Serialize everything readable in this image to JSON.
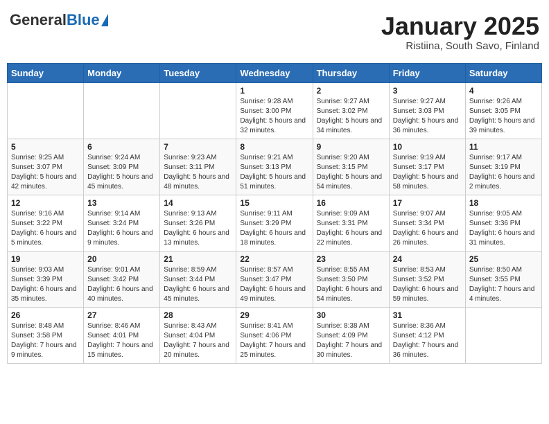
{
  "header": {
    "logo_general": "General",
    "logo_blue": "Blue",
    "month_title": "January 2025",
    "subtitle": "Ristiina, South Savo, Finland"
  },
  "weekdays": [
    "Sunday",
    "Monday",
    "Tuesday",
    "Wednesday",
    "Thursday",
    "Friday",
    "Saturday"
  ],
  "weeks": [
    [
      {
        "day": "",
        "text": ""
      },
      {
        "day": "",
        "text": ""
      },
      {
        "day": "",
        "text": ""
      },
      {
        "day": "1",
        "text": "Sunrise: 9:28 AM\nSunset: 3:00 PM\nDaylight: 5 hours and 32 minutes."
      },
      {
        "day": "2",
        "text": "Sunrise: 9:27 AM\nSunset: 3:02 PM\nDaylight: 5 hours and 34 minutes."
      },
      {
        "day": "3",
        "text": "Sunrise: 9:27 AM\nSunset: 3:03 PM\nDaylight: 5 hours and 36 minutes."
      },
      {
        "day": "4",
        "text": "Sunrise: 9:26 AM\nSunset: 3:05 PM\nDaylight: 5 hours and 39 minutes."
      }
    ],
    [
      {
        "day": "5",
        "text": "Sunrise: 9:25 AM\nSunset: 3:07 PM\nDaylight: 5 hours and 42 minutes."
      },
      {
        "day": "6",
        "text": "Sunrise: 9:24 AM\nSunset: 3:09 PM\nDaylight: 5 hours and 45 minutes."
      },
      {
        "day": "7",
        "text": "Sunrise: 9:23 AM\nSunset: 3:11 PM\nDaylight: 5 hours and 48 minutes."
      },
      {
        "day": "8",
        "text": "Sunrise: 9:21 AM\nSunset: 3:13 PM\nDaylight: 5 hours and 51 minutes."
      },
      {
        "day": "9",
        "text": "Sunrise: 9:20 AM\nSunset: 3:15 PM\nDaylight: 5 hours and 54 minutes."
      },
      {
        "day": "10",
        "text": "Sunrise: 9:19 AM\nSunset: 3:17 PM\nDaylight: 5 hours and 58 minutes."
      },
      {
        "day": "11",
        "text": "Sunrise: 9:17 AM\nSunset: 3:19 PM\nDaylight: 6 hours and 2 minutes."
      }
    ],
    [
      {
        "day": "12",
        "text": "Sunrise: 9:16 AM\nSunset: 3:22 PM\nDaylight: 6 hours and 5 minutes."
      },
      {
        "day": "13",
        "text": "Sunrise: 9:14 AM\nSunset: 3:24 PM\nDaylight: 6 hours and 9 minutes."
      },
      {
        "day": "14",
        "text": "Sunrise: 9:13 AM\nSunset: 3:26 PM\nDaylight: 6 hours and 13 minutes."
      },
      {
        "day": "15",
        "text": "Sunrise: 9:11 AM\nSunset: 3:29 PM\nDaylight: 6 hours and 18 minutes."
      },
      {
        "day": "16",
        "text": "Sunrise: 9:09 AM\nSunset: 3:31 PM\nDaylight: 6 hours and 22 minutes."
      },
      {
        "day": "17",
        "text": "Sunrise: 9:07 AM\nSunset: 3:34 PM\nDaylight: 6 hours and 26 minutes."
      },
      {
        "day": "18",
        "text": "Sunrise: 9:05 AM\nSunset: 3:36 PM\nDaylight: 6 hours and 31 minutes."
      }
    ],
    [
      {
        "day": "19",
        "text": "Sunrise: 9:03 AM\nSunset: 3:39 PM\nDaylight: 6 hours and 35 minutes."
      },
      {
        "day": "20",
        "text": "Sunrise: 9:01 AM\nSunset: 3:42 PM\nDaylight: 6 hours and 40 minutes."
      },
      {
        "day": "21",
        "text": "Sunrise: 8:59 AM\nSunset: 3:44 PM\nDaylight: 6 hours and 45 minutes."
      },
      {
        "day": "22",
        "text": "Sunrise: 8:57 AM\nSunset: 3:47 PM\nDaylight: 6 hours and 49 minutes."
      },
      {
        "day": "23",
        "text": "Sunrise: 8:55 AM\nSunset: 3:50 PM\nDaylight: 6 hours and 54 minutes."
      },
      {
        "day": "24",
        "text": "Sunrise: 8:53 AM\nSunset: 3:52 PM\nDaylight: 6 hours and 59 minutes."
      },
      {
        "day": "25",
        "text": "Sunrise: 8:50 AM\nSunset: 3:55 PM\nDaylight: 7 hours and 4 minutes."
      }
    ],
    [
      {
        "day": "26",
        "text": "Sunrise: 8:48 AM\nSunset: 3:58 PM\nDaylight: 7 hours and 9 minutes."
      },
      {
        "day": "27",
        "text": "Sunrise: 8:46 AM\nSunset: 4:01 PM\nDaylight: 7 hours and 15 minutes."
      },
      {
        "day": "28",
        "text": "Sunrise: 8:43 AM\nSunset: 4:04 PM\nDaylight: 7 hours and 20 minutes."
      },
      {
        "day": "29",
        "text": "Sunrise: 8:41 AM\nSunset: 4:06 PM\nDaylight: 7 hours and 25 minutes."
      },
      {
        "day": "30",
        "text": "Sunrise: 8:38 AM\nSunset: 4:09 PM\nDaylight: 7 hours and 30 minutes."
      },
      {
        "day": "31",
        "text": "Sunrise: 8:36 AM\nSunset: 4:12 PM\nDaylight: 7 hours and 36 minutes."
      },
      {
        "day": "",
        "text": ""
      }
    ]
  ]
}
